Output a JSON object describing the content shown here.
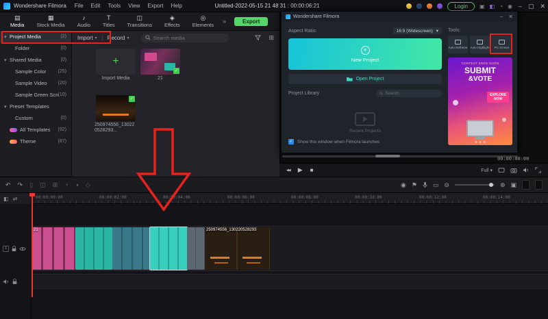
{
  "menubar": {
    "app_title": "Wondershare Filmora",
    "menus": [
      "File",
      "Edit",
      "Tools",
      "View",
      "Export",
      "Help"
    ],
    "doc_title": "Untitled-2022-05-15 21 48 31 : 00:00:06:21",
    "login_label": "Login"
  },
  "icons": {
    "caret_down": "▾",
    "chevron_more": "»",
    "minimize": "–",
    "maximize": "▢",
    "close": "✕",
    "snapshot": "▣",
    "gift": "◧",
    "bell": "◔",
    "user": "◉",
    "grid": "⊞",
    "undo": "↶",
    "redo": "↷",
    "trash": "▯",
    "split": "◫",
    "crop": "⊞",
    "speed": "◔",
    "color": "◑",
    "keyframe": "◇",
    "render": "◉",
    "marker": "⚑",
    "record_screen": "▭",
    "zoom_out": "⊖",
    "zoom_in": "⊕",
    "fit": "▣",
    "layers": "◧",
    "swap": "⇄",
    "prev": "‹",
    "next": "›",
    "step_back": "◀◀",
    "play": "▶",
    "stop": "■",
    "plus": "+",
    "check": "✓"
  },
  "ribbon": {
    "tabs": [
      {
        "label": "Media",
        "icon": "▤"
      },
      {
        "label": "Stock Media",
        "icon": "▦"
      },
      {
        "label": "Audio",
        "icon": "♪"
      },
      {
        "label": "Titles",
        "icon": "T"
      },
      {
        "label": "Transitions",
        "icon": "◫"
      },
      {
        "label": "Effects",
        "icon": "◈"
      },
      {
        "label": "Elements",
        "icon": "◎"
      }
    ],
    "export_label": "Export"
  },
  "sidebar": {
    "items": [
      {
        "label": "Project Media",
        "count": "(2)"
      },
      {
        "label": "Folder",
        "count": "(0)"
      },
      {
        "label": "Shared Media",
        "count": "(0)"
      },
      {
        "label": "Sample Color",
        "count": "(25)"
      },
      {
        "label": "Sample Video",
        "count": "(20)"
      },
      {
        "label": "Sample Green Screen",
        "count": "(10)"
      },
      {
        "label": "Preset Templates",
        "count": ""
      },
      {
        "label": "Custom",
        "count": "(0)"
      },
      {
        "label": "All Templates",
        "count": "(92)"
      },
      {
        "label": "Theme",
        "count": "(87)"
      }
    ]
  },
  "media_panel": {
    "import_label": "Import",
    "record_label": "Record",
    "search_placeholder": "Search media",
    "items": [
      {
        "caption": "Import Media"
      },
      {
        "caption": "21"
      },
      {
        "caption": "250974556_130220528293..."
      }
    ]
  },
  "startup": {
    "window_title": "Wondershare Filmora",
    "aspect_label": "Aspect Ratio:",
    "aspect_value": "16:9 (Widescreen)",
    "new_project": "New Project",
    "open_project": "Open Project",
    "project_library": "Project Library",
    "search_placeholder": "Search",
    "recent_projects": "Recent Projects",
    "launch_checkbox": "Show this window when Filmora launches",
    "tools_label": "Tools:",
    "tools": [
      {
        "label": "Auto Reframe"
      },
      {
        "label": "Auto Highlight"
      },
      {
        "label": "PC Screen"
      }
    ],
    "promo": {
      "tagline": "CONTEST ENDS SOON",
      "title": "SUBMIT",
      "subtitle": "&VOTE",
      "cta1": "EXPLORE",
      "cta2": "NOW"
    }
  },
  "preview": {
    "timecode": "00:00:00:00",
    "zoom_value": "Full"
  },
  "timeline": {
    "ruler": [
      "00:00:00:00",
      "00:00:02:00",
      "00:00:04:00",
      "00:00:06:00",
      "00:00:08:00",
      "00:00:10:00",
      "00:00:12:00",
      "00:00:14:00"
    ],
    "clips": [
      {
        "label": "21"
      },
      {
        "label": "250974556_130220528293"
      }
    ],
    "video_track_number": "1"
  }
}
